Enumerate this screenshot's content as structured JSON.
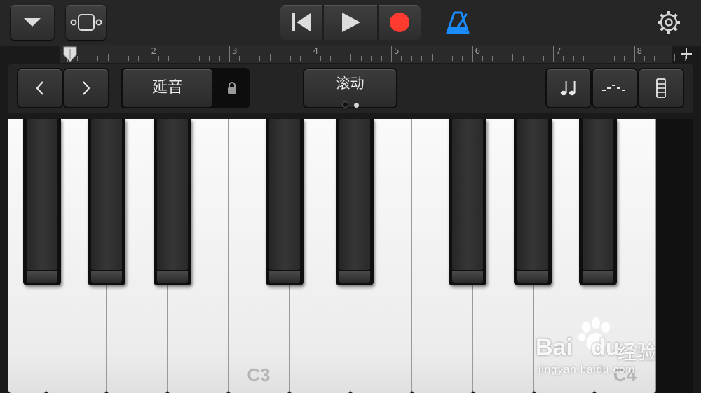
{
  "toolbar": {
    "icons": {
      "dropdown": "chevron-down-icon",
      "view": "view-toggle-icon",
      "rewind": "go-to-beginning-icon",
      "play": "play-icon",
      "record": "record-icon",
      "metronome": "metronome-icon",
      "settings": "gear-icon"
    },
    "colors": {
      "record": "#ff3b30",
      "metronome": "#1a8cff"
    }
  },
  "ruler": {
    "bars": [
      "1",
      "2",
      "3",
      "4",
      "5",
      "6",
      "7",
      "8"
    ],
    "add_icon": "plus-icon"
  },
  "controls": {
    "octave_down_icon": "chevron-left-icon",
    "octave_up_icon": "chevron-right-icon",
    "sustain_label": "延音",
    "lock_icon": "lock-icon",
    "scroll_label": "滚动",
    "scroll_pages": 2,
    "scroll_active_page": 2,
    "right_icons": [
      "music-notes-icon",
      "arpeggiator-icon",
      "keyboard-size-icon"
    ]
  },
  "keyboard": {
    "white_labels": [
      "",
      "",
      "",
      "",
      "C3",
      "",
      "",
      "",
      "",
      "",
      "C4"
    ],
    "black_count": 8
  },
  "watermark": {
    "brand": "Bai",
    "brand_suffix": "du",
    "product": "经验",
    "url": "jingyan.baidu.com"
  }
}
